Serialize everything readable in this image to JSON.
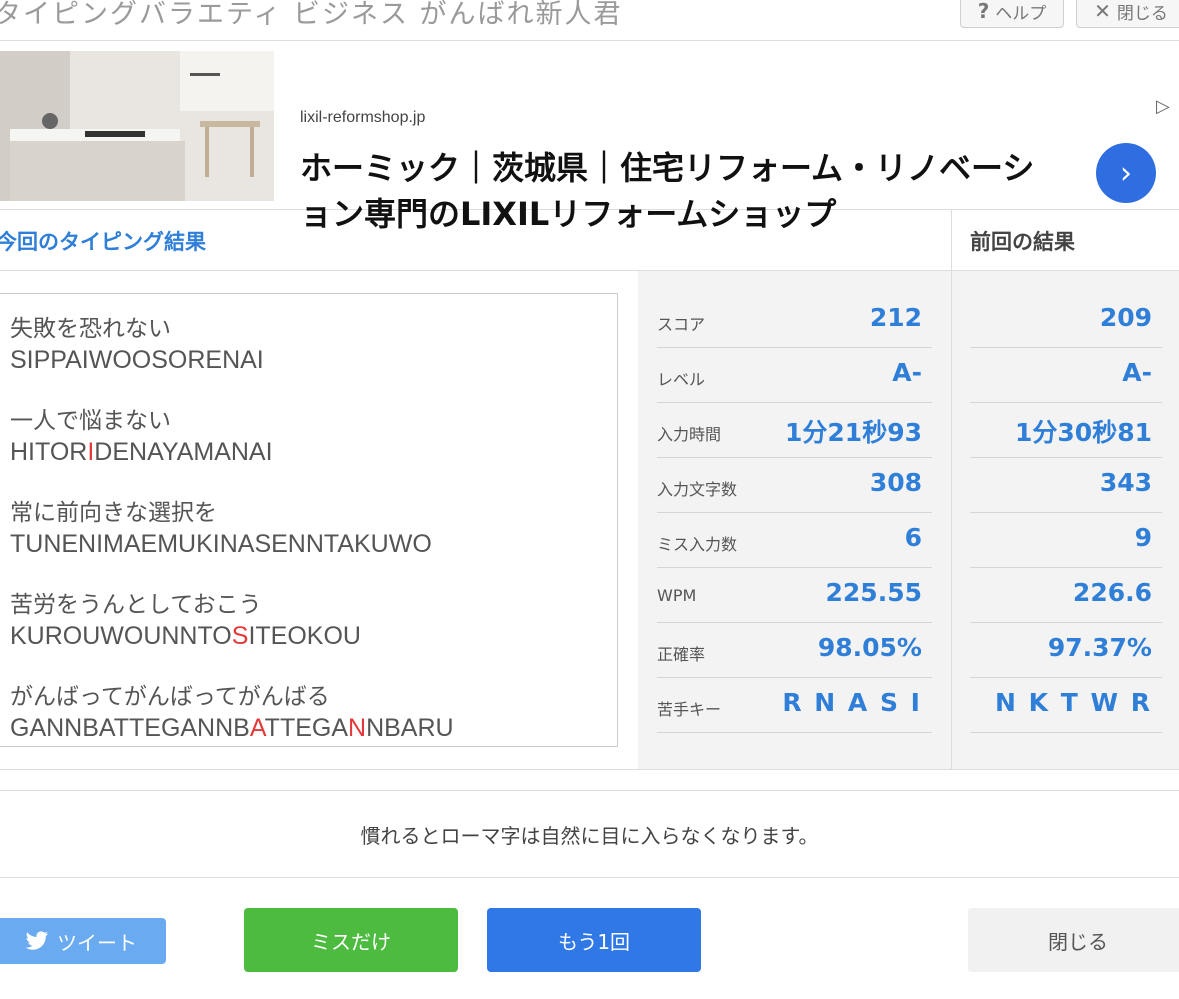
{
  "header": {
    "title": "タイピングバラエティ ビジネス がんばれ新人君",
    "help_label": "ヘルプ",
    "close_label": "閉じる"
  },
  "ad": {
    "domain": "lixil-reformshop.jp",
    "text": "ホーミック｜茨城県｜住宅リフォーム・リノベーション専門のLIXILリフォームショップ"
  },
  "results": {
    "title": "今回のタイピング結果",
    "prev_title": "前回の結果",
    "words": [
      {
        "jp": "失敗を恐れない",
        "ro": [
          {
            "t": "SIPPAIWOOSORENAI",
            "m": false
          }
        ]
      },
      {
        "jp": "一人で悩まない",
        "ro": [
          {
            "t": "HITOR",
            "m": false
          },
          {
            "t": "I",
            "m": true
          },
          {
            "t": "DENAYAMANAI",
            "m": false
          }
        ]
      },
      {
        "jp": "常に前向きな選択を",
        "ro": [
          {
            "t": "TUNENIMAEMUKINASENNTAKUWO",
            "m": false
          }
        ]
      },
      {
        "jp": "苦労をうんとしておこう",
        "ro": [
          {
            "t": "KUROUWOUNNTO",
            "m": false
          },
          {
            "t": "S",
            "m": true
          },
          {
            "t": "ITEOKOU",
            "m": false
          }
        ]
      },
      {
        "jp": "がんばってがんばってがんばる",
        "ro": [
          {
            "t": "GANNBATTEGANNB",
            "m": false
          },
          {
            "t": "A",
            "m": true
          },
          {
            "t": "TTEGA",
            "m": false
          },
          {
            "t": "N",
            "m": true
          },
          {
            "t": "NBARU",
            "m": false
          }
        ]
      }
    ],
    "stats": [
      {
        "label": "スコア",
        "current": "212",
        "previous": "209"
      },
      {
        "label": "レベル",
        "current": "A-",
        "previous": "A-"
      },
      {
        "label": "入力時間",
        "current": "1分21秒93",
        "previous": "1分30秒81"
      },
      {
        "label": "入力文字数",
        "current": "308",
        "previous": "343"
      },
      {
        "label": "ミス入力数",
        "current": "6",
        "previous": "9"
      },
      {
        "label": "WPM",
        "current": "225.55",
        "previous": "226.6"
      },
      {
        "label": "正確率",
        "current": "98.05%",
        "previous": "97.37%"
      },
      {
        "label": "苦手キー",
        "current": "RNASI",
        "previous": "NKTWR"
      }
    ]
  },
  "hint": "慣れるとローマ字は自然に目に入らなくなります。",
  "buttons": {
    "tweet": "ツイート",
    "miss_only": "ミスだけ",
    "again": "もう1回",
    "close": "閉じる"
  }
}
